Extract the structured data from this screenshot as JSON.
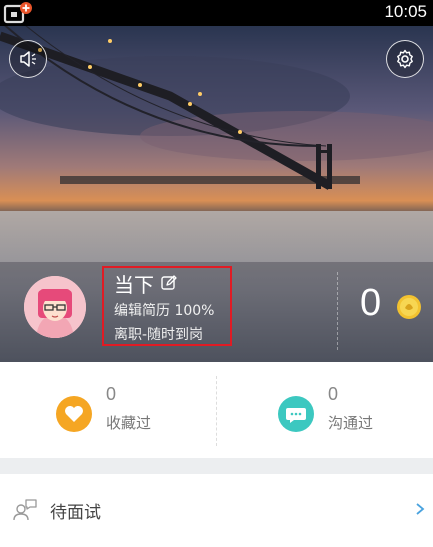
{
  "status_bar": {
    "time": "10:05"
  },
  "profile": {
    "name": "当下",
    "resume_label": "编辑简历",
    "resume_completion": "100%",
    "job_status": "离职-随时到岗",
    "coins": "0"
  },
  "stats": {
    "favorited": {
      "count": "0",
      "label": "收藏过"
    },
    "contacted": {
      "count": "0",
      "label": "沟通过"
    }
  },
  "menu": {
    "items": [
      {
        "label": "待面试"
      }
    ]
  },
  "colors": {
    "fav_orange": "#f5a623",
    "chat_teal": "#3cc8c0",
    "highlight_red": "#e01b24",
    "chevron_blue": "#4aa3df"
  }
}
